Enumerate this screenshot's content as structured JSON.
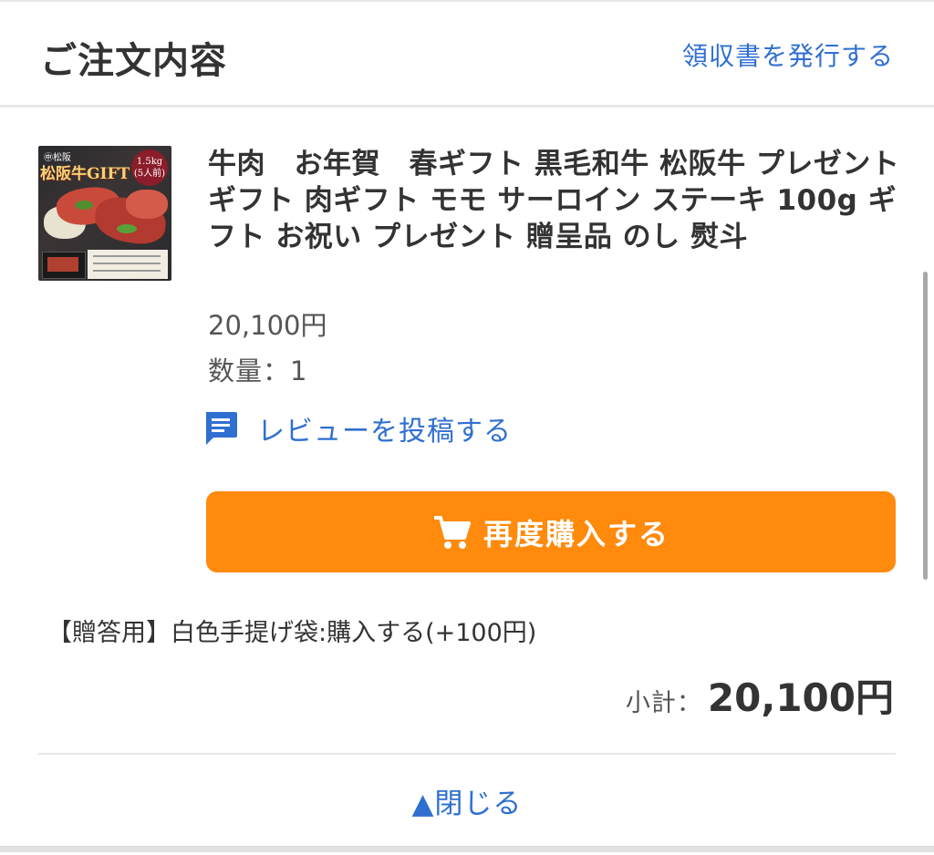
{
  "header": {
    "title": "ご注文内容",
    "receipt_link": "領収書を発行する"
  },
  "item": {
    "title": "牛肉　お年賀　春ギフト 黒毛和牛 松阪牛 プレゼント ギフト 肉ギフト モモ サーロイン ステーキ 100g ギフト お祝い プレゼント 贈呈品 のし 熨斗",
    "image": {
      "brand_text": "㊥松阪",
      "label": "松阪牛GIFT",
      "weight_badge_line1": "1.5kg",
      "weight_badge_line2": "(5人前)"
    },
    "price": "20,100円",
    "quantity": "数量：1",
    "review": {
      "icon": "comment-icon",
      "label": "レビューを投稿する"
    },
    "rebuy_button": {
      "icon": "cart-icon",
      "label": "再度購入する",
      "color": "#ff8a0c"
    }
  },
  "gift_option": "【贈答用】白色手提げ袋:購入する(+100円)",
  "subtotal": {
    "label": "小計：",
    "value": "20,100円"
  },
  "close_toggle": "▲閉じる",
  "colors": {
    "link": "#2f6fd1",
    "accent": "#ff8a0c",
    "text": "#333333"
  }
}
